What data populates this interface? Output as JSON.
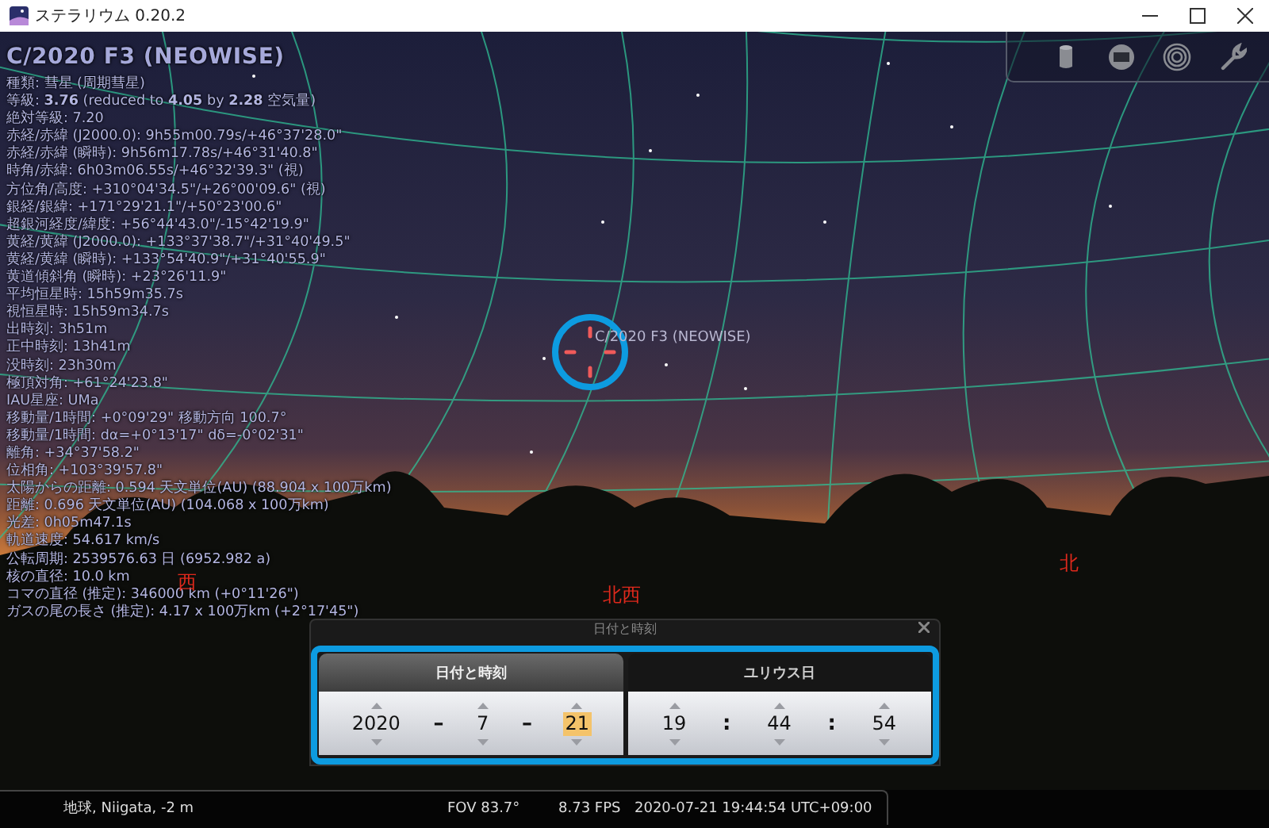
{
  "window": {
    "title": "ステラリウム 0.20.2"
  },
  "object_info": {
    "title": "C/2020 F3 (NEOWISE)",
    "lines": [
      "種類: 彗星 (周期彗星)",
      "等級: **3.76** (reduced to **4.05** by **2.28** 空気量)",
      "絶対等級: 7.20",
      "赤経/赤緯 (J2000.0): 9h55m00.79s/+46°37'28.0\"",
      "赤経/赤緯 (瞬時): 9h56m17.78s/+46°31'40.8\"",
      "時角/赤緯: 6h03m06.55s/+46°32'39.3\" (視)",
      "方位角/高度: +310°04'34.5\"/+26°00'09.6\" (視)",
      "銀経/銀緯: +171°29'21.1\"/+50°23'00.6\"",
      "超銀河経度/緯度: +56°44'43.0\"/-15°42'19.9\"",
      "黄経/黄緯 (J2000.0): +133°37'38.7\"/+31°40'49.5\"",
      "黄経/黄緯 (瞬時): +133°54'40.9\"/+31°40'55.9\"",
      "黄道傾斜角 (瞬時): +23°26'11.9\"",
      "平均恒星時: 15h59m35.7s",
      "視恒星時: 15h59m34.7s",
      "出時刻: 3h51m",
      "正中時刻: 13h41m",
      "没時刻: 23h30m",
      "極頂対角: +61°24'23.8\"",
      "IAU星座: UMa",
      "移動量/1時間: +0°09'29\" 移動方向 100.7°",
      "移動量/1時間: dα=+0°13'17\" dδ=-0°02'31\"",
      "離角: +34°37'58.2\"",
      "位相角: +103°39'57.8\"",
      "太陽からの距離: 0.594 天文単位(AU) (88.904 x 100万km)",
      "距離: 0.696 天文単位(AU) (104.068 x 100万km)",
      "光差: 0h05m47.1s",
      "軌道速度: 54.617 km/s",
      "公転周期: 2539576.63 日 (6952.982 a)",
      "核の直径: 10.0 km",
      "コマの直径 (推定): 346000 km (+0°11'26\")",
      "ガスの尾の長さ (推定): 4.17 x 100万km (+2°17'45\")"
    ]
  },
  "sky": {
    "target_label": "C/2020 F3 (NEOWISE)",
    "compass": [
      {
        "label": "西"
      },
      {
        "label": "北西"
      },
      {
        "label": "北"
      }
    ]
  },
  "date_dialog": {
    "title": "日付と時刻",
    "tabs": [
      {
        "label": "日付と時刻",
        "selected": true
      },
      {
        "label": "ユリウス日",
        "selected": false
      }
    ],
    "groups": [
      {
        "items": [
          {
            "kind": "field",
            "value": "2020",
            "selected": false
          },
          {
            "kind": "separator",
            "value": "–"
          },
          {
            "kind": "field",
            "value": "7",
            "selected": false
          },
          {
            "kind": "separator",
            "value": "–"
          },
          {
            "kind": "field",
            "value": "21",
            "selected": true
          }
        ]
      },
      {
        "items": [
          {
            "kind": "field",
            "value": "19",
            "selected": false
          },
          {
            "kind": "separator",
            "value": ":"
          },
          {
            "kind": "field",
            "value": "44",
            "selected": false
          },
          {
            "kind": "separator",
            "value": ":"
          },
          {
            "kind": "field",
            "value": "54",
            "selected": false
          }
        ]
      }
    ]
  },
  "status_bar": {
    "location": "地球, Niigata, -2 m",
    "fov": "FOV 83.7°",
    "fps": "8.73 FPS",
    "datetime": "2020-07-21 19:44:54 UTC+09:00"
  }
}
